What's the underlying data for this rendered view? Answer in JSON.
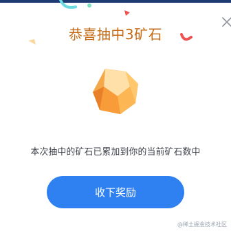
{
  "dialog": {
    "title": "恭喜抽中3矿石",
    "message": "本次抽中的矿石已累加到你的当前矿石数中",
    "claim_button_label": "收下奖励",
    "close_icon": "close-icon",
    "reward_icon": "ore-stone-icon"
  },
  "watermark": {
    "text": "@稀土掘金技术社区"
  },
  "colors": {
    "title": "#c46a14",
    "button": "#2f80f0",
    "ore_light": "#ffd48a",
    "ore_dark": "#f08c2a",
    "confetti_cyan": "#6ad9e0",
    "confetti_red": "#ef5050",
    "confetti_orange": "#f5a63c",
    "top_band": "#1e3a73"
  }
}
